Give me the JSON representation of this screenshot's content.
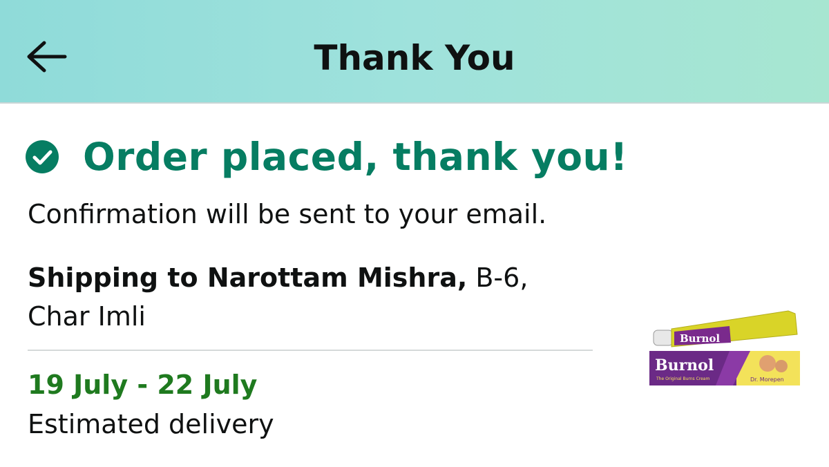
{
  "header": {
    "title": "Thank You",
    "back_icon": "arrow-left-icon",
    "gradient": [
      "#8fdbd9",
      "#a7e6d1"
    ]
  },
  "status": {
    "icon": "check-circle-icon",
    "message": "Order placed, thank you!",
    "color": "#067d62"
  },
  "confirmation": "Confirmation will be sent to your email.",
  "shipping": {
    "prefix": "Shipping to Narottam Mishra,",
    "address": " B-6, Char Imli"
  },
  "delivery": {
    "range": "19 July - 22 July",
    "label": "Estimated delivery",
    "color": "#1f7a1f"
  },
  "product": {
    "brand": "Burnol",
    "tagline": "The Original Burns Cream",
    "maker": "Dr. Morepen"
  }
}
